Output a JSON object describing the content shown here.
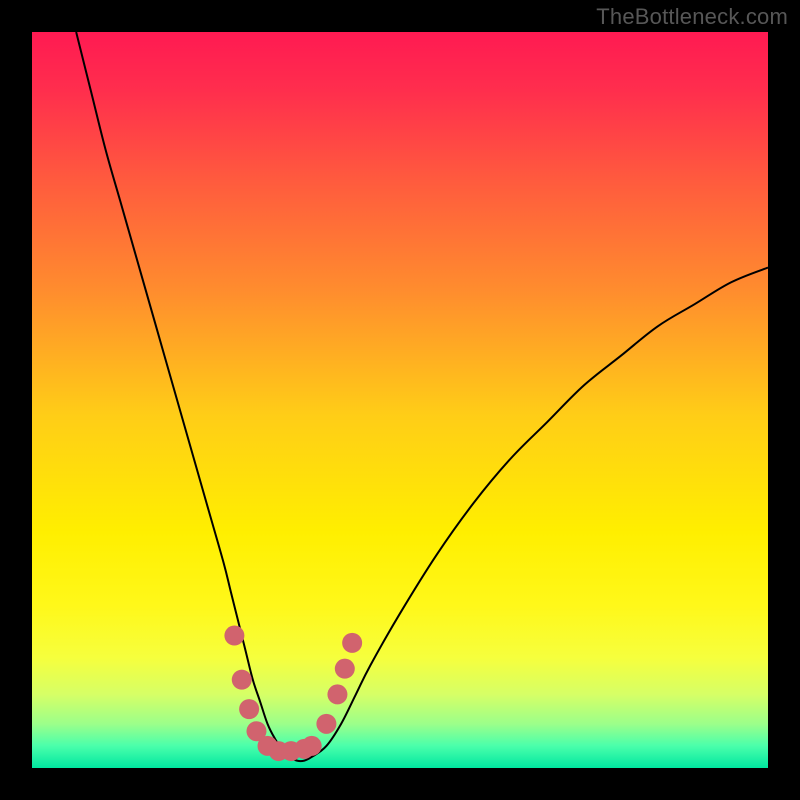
{
  "watermark": "TheBottleneck.com",
  "chart_data": {
    "type": "line",
    "title": "",
    "xlabel": "",
    "ylabel": "",
    "xlim": [
      0,
      100
    ],
    "ylim": [
      0,
      100
    ],
    "grid": false,
    "legend": false,
    "background_gradient": {
      "stops": [
        {
          "offset": 0.0,
          "color": "#ff1a52"
        },
        {
          "offset": 0.08,
          "color": "#ff2e4d"
        },
        {
          "offset": 0.2,
          "color": "#ff5a3e"
        },
        {
          "offset": 0.35,
          "color": "#ff8c2e"
        },
        {
          "offset": 0.52,
          "color": "#ffcd17"
        },
        {
          "offset": 0.68,
          "color": "#ffef00"
        },
        {
          "offset": 0.78,
          "color": "#fff81a"
        },
        {
          "offset": 0.85,
          "color": "#f6ff3d"
        },
        {
          "offset": 0.9,
          "color": "#d6ff66"
        },
        {
          "offset": 0.94,
          "color": "#9cff8a"
        },
        {
          "offset": 0.97,
          "color": "#4affab"
        },
        {
          "offset": 1.0,
          "color": "#00e7a0"
        }
      ]
    },
    "series": [
      {
        "name": "bottleneck-curve",
        "color": "#000000",
        "stroke_width": 2,
        "x": [
          6,
          8,
          10,
          12,
          14,
          16,
          18,
          20,
          22,
          24,
          26,
          27,
          28,
          29,
          30,
          31,
          32,
          33,
          34,
          35,
          36,
          37,
          38,
          40,
          42,
          44,
          46,
          50,
          55,
          60,
          65,
          70,
          75,
          80,
          85,
          90,
          95,
          100
        ],
        "y": [
          100,
          92,
          84,
          77,
          70,
          63,
          56,
          49,
          42,
          35,
          28,
          24,
          20,
          16,
          12,
          9,
          6,
          4,
          2.5,
          1.5,
          1,
          1,
          1.5,
          3,
          6,
          10,
          14,
          21,
          29,
          36,
          42,
          47,
          52,
          56,
          60,
          63,
          66,
          68
        ]
      }
    ],
    "markers": {
      "name": "highlight-dots",
      "color": "#d1636e",
      "radius": 10,
      "points": [
        {
          "x": 27.5,
          "y": 18
        },
        {
          "x": 28.5,
          "y": 12
        },
        {
          "x": 29.5,
          "y": 8
        },
        {
          "x": 30.5,
          "y": 5
        },
        {
          "x": 32.0,
          "y": 3
        },
        {
          "x": 33.5,
          "y": 2.3
        },
        {
          "x": 35.2,
          "y": 2.3
        },
        {
          "x": 37.0,
          "y": 2.6
        },
        {
          "x": 38.0,
          "y": 3
        },
        {
          "x": 40.0,
          "y": 6
        },
        {
          "x": 41.5,
          "y": 10
        },
        {
          "x": 42.5,
          "y": 13.5
        },
        {
          "x": 43.5,
          "y": 17
        }
      ]
    }
  }
}
